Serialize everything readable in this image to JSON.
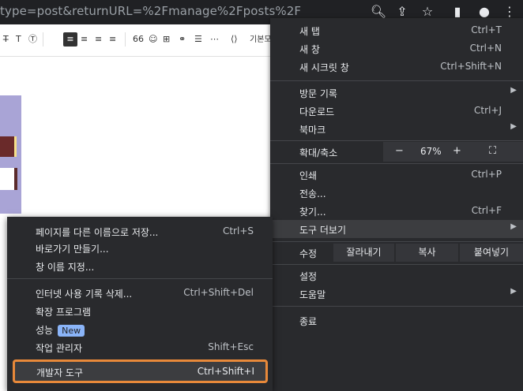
{
  "browser": {
    "url_fragment": "type=post&returnURL=%2Fmanage%2Fposts%2F"
  },
  "editor": {
    "toolbar_text_label": "기본모"
  },
  "chrome_menu": {
    "items": [
      {
        "label": "새 탭",
        "shortcut": "Ctrl+T"
      },
      {
        "label": "새 창",
        "shortcut": "Ctrl+N"
      },
      {
        "label": "새 시크릿 창",
        "shortcut": "Ctrl+Shift+N"
      },
      {
        "label": "방문 기록",
        "shortcut": ""
      },
      {
        "label": "다운로드",
        "shortcut": "Ctrl+J"
      },
      {
        "label": "북마크",
        "shortcut": ""
      },
      {
        "label": "인쇄",
        "shortcut": "Ctrl+P"
      },
      {
        "label": "전송...",
        "shortcut": ""
      },
      {
        "label": "찾기...",
        "shortcut": "Ctrl+F"
      },
      {
        "label": "도구 더보기",
        "shortcut": ""
      },
      {
        "label": "설정",
        "shortcut": ""
      },
      {
        "label": "도움말",
        "shortcut": ""
      },
      {
        "label": "종료",
        "shortcut": ""
      }
    ],
    "zoom": {
      "label": "확대/축소",
      "minus": "−",
      "value": "67%",
      "plus": "+",
      "fullscreen": "⛶"
    },
    "edit": {
      "label": "수정",
      "cut": "잘라내기",
      "copy": "복사",
      "paste": "붙여넣기"
    }
  },
  "submenu": {
    "items": [
      {
        "label": "페이지를 다른 이름으로 저장...",
        "shortcut": "Ctrl+S"
      },
      {
        "label": "바로가기 만들기...",
        "shortcut": ""
      },
      {
        "label": "창 이름 지정...",
        "shortcut": ""
      },
      {
        "label": "인터넷 사용 기록 삭제...",
        "shortcut": "Ctrl+Shift+Del"
      },
      {
        "label": "확장 프로그램",
        "shortcut": ""
      },
      {
        "label": "성능",
        "shortcut": "",
        "badge": "New"
      },
      {
        "label": "작업 관리자",
        "shortcut": "Shift+Esc"
      },
      {
        "label": "개발자 도구",
        "shortcut": "Ctrl+Shift+I"
      }
    ]
  }
}
